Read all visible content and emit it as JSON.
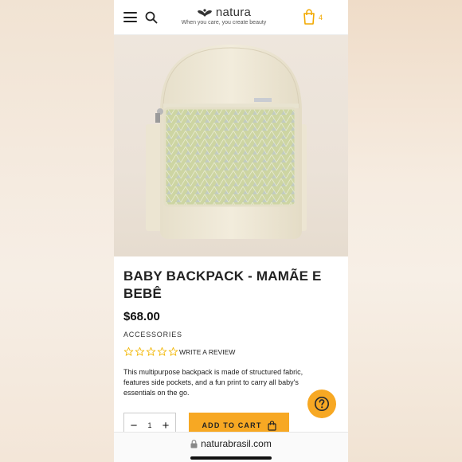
{
  "header": {
    "logo_text": "natura",
    "tagline": "When you care, you create beauty",
    "bag_count": "4"
  },
  "product": {
    "title": "BABY BACKPACK - MAMÃE E BEBÊ",
    "price": "$68.00",
    "category": "ACCESSORIES",
    "rating_stars_filled": 0,
    "rating_stars_total": 5,
    "write_review_label": "WRITE A REVIEW",
    "description": "This multipurpose backpack is made of structured fabric, features side pockets, and a fun print to carry all baby's essentials on the go."
  },
  "purchase": {
    "decrement_label": "−",
    "quantity": "1",
    "increment_label": "+",
    "add_to_cart_label": "ADD TO CART"
  },
  "browser": {
    "url": "naturabrasil.com"
  },
  "colors": {
    "accent": "#f7a823",
    "star_outline": "#f2b705",
    "backpack_body": "#efe8d6",
    "backpack_pocket": "#cfd6a4"
  },
  "icons": {
    "menu": "menu-icon",
    "search": "search-icon",
    "logo": "natura-logo-icon",
    "bag": "shopping-bag-icon",
    "help": "question-mark-icon",
    "lock": "lock-icon",
    "cart_bag": "bag-icon"
  }
}
